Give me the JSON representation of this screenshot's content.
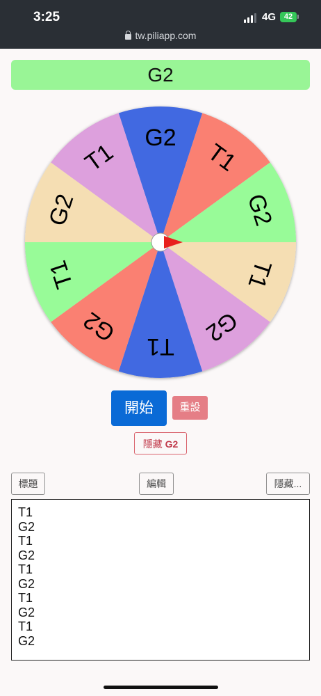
{
  "status_bar": {
    "time": "3:25",
    "network": "4G",
    "battery": "42"
  },
  "browser": {
    "url": "tw.piliapp.com"
  },
  "result": {
    "text": "G2"
  },
  "wheel": {
    "slices": [
      {
        "label": "G2",
        "color": "#4169e1"
      },
      {
        "label": "T1",
        "color": "#fa8072"
      },
      {
        "label": "G2",
        "color": "#98fb98"
      },
      {
        "label": "T1",
        "color": "#f5deb3"
      },
      {
        "label": "G2",
        "color": "#dda0dd"
      },
      {
        "label": "T1",
        "color": "#4169e1"
      },
      {
        "label": "G2",
        "color": "#fa8072"
      },
      {
        "label": "T1",
        "color": "#98fb98"
      },
      {
        "label": "G2",
        "color": "#f5deb3"
      },
      {
        "label": "T1",
        "color": "#dda0dd"
      }
    ],
    "pointer_color": "#e8201e"
  },
  "controls": {
    "start_label": "開始",
    "reset_label": "重設",
    "hide_result_prefix": "隱藏",
    "hide_result_value": "G2",
    "title_label": "標題",
    "edit_label": "編輯",
    "hide_label": "隱藏..."
  },
  "list": {
    "items": [
      "T1",
      "G2",
      "T1",
      "G2",
      "T1",
      "G2",
      "T1",
      "G2",
      "T1",
      "G2"
    ]
  }
}
